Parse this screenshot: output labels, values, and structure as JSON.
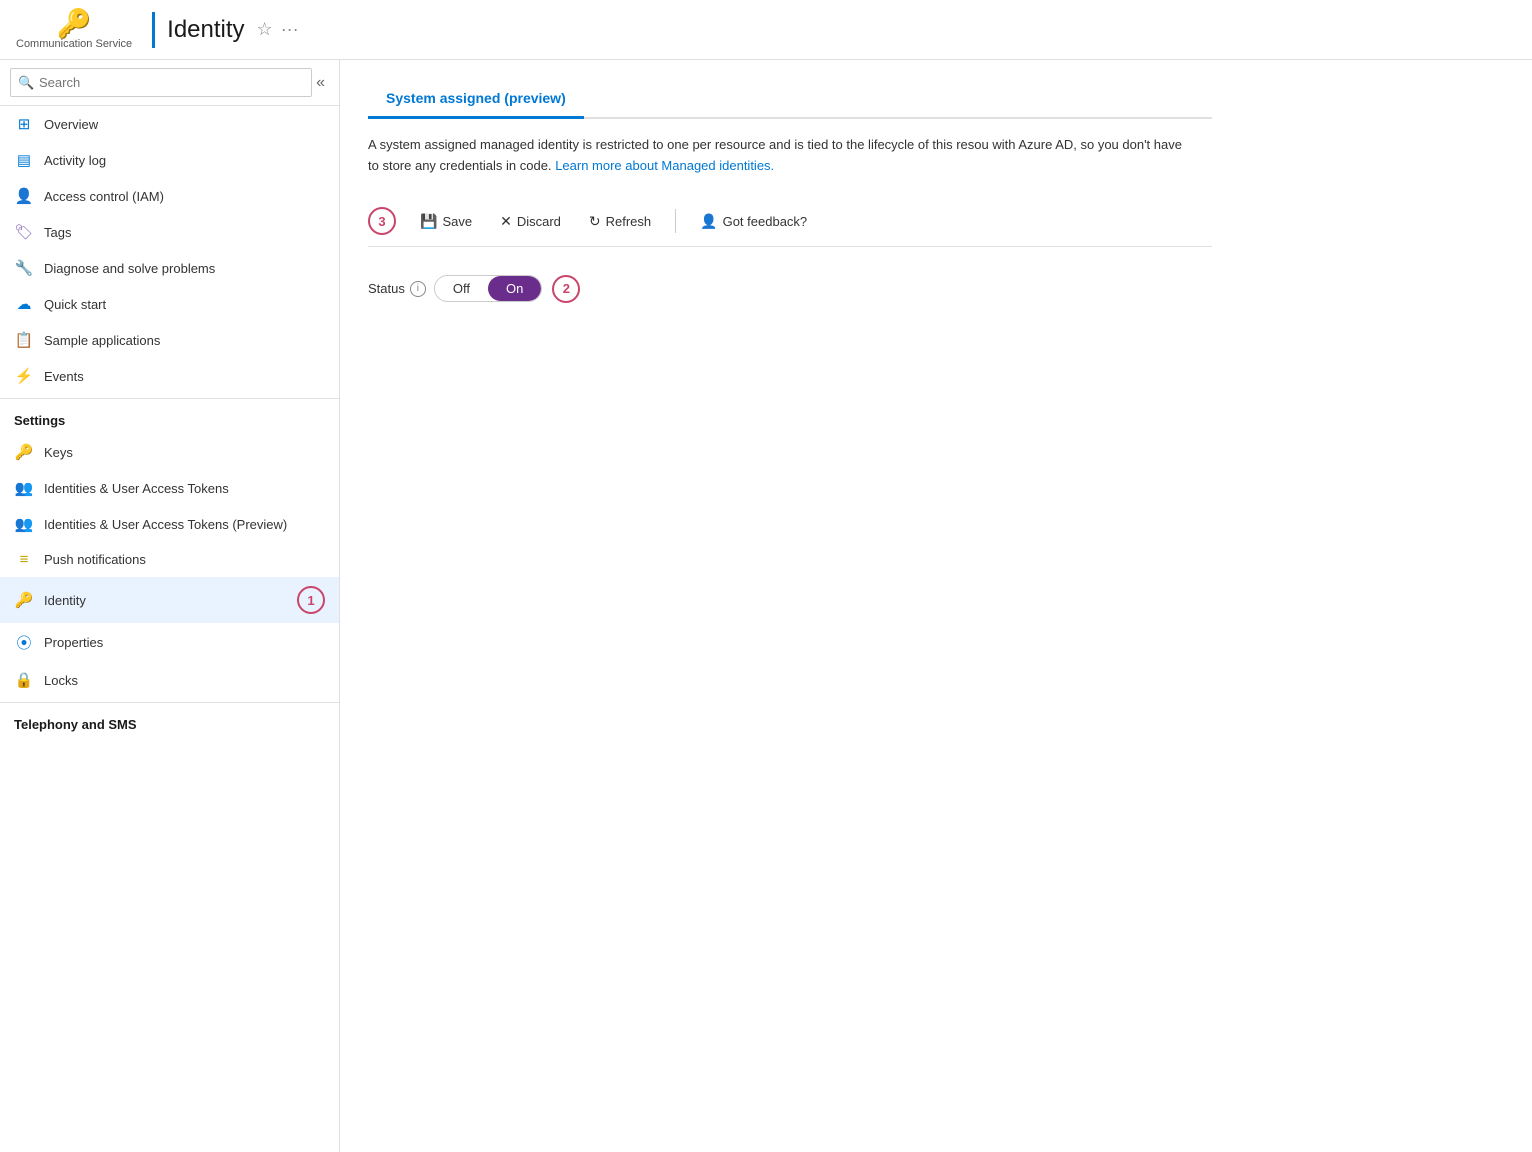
{
  "header": {
    "logo_icon": "🔑",
    "logo_subtitle": "Communication Service",
    "divider_visible": true,
    "title": "Identity",
    "star_icon": "☆",
    "more_icon": "···"
  },
  "sidebar": {
    "search_placeholder": "Search",
    "collapse_icon": "«",
    "items": [
      {
        "id": "overview",
        "label": "Overview",
        "icon": "⊞",
        "icon_color": "icon-blue",
        "active": false
      },
      {
        "id": "activity-log",
        "label": "Activity log",
        "icon": "≡",
        "icon_color": "icon-blue",
        "active": false
      },
      {
        "id": "access-control",
        "label": "Access control (IAM)",
        "icon": "👤",
        "icon_color": "icon-blue",
        "active": false
      },
      {
        "id": "tags",
        "label": "Tags",
        "icon": "🏷",
        "icon_color": "icon-purple",
        "active": false
      },
      {
        "id": "diagnose",
        "label": "Diagnose and solve problems",
        "icon": "🔧",
        "icon_color": "icon-blue",
        "active": false
      },
      {
        "id": "quick-start",
        "label": "Quick start",
        "icon": "☁",
        "icon_color": "icon-blue",
        "active": false
      },
      {
        "id": "sample-applications",
        "label": "Sample applications",
        "icon": "📋",
        "icon_color": "icon-blue",
        "active": false
      },
      {
        "id": "events",
        "label": "Events",
        "icon": "⚡",
        "icon_color": "icon-orange",
        "active": false
      }
    ],
    "settings_section": {
      "label": "Settings",
      "items": [
        {
          "id": "keys",
          "label": "Keys",
          "icon": "🔑",
          "icon_color": "icon-gold",
          "active": false
        },
        {
          "id": "identities-tokens",
          "label": "Identities & User Access Tokens",
          "icon": "👥",
          "icon_color": "icon-teal",
          "active": false
        },
        {
          "id": "identities-tokens-preview",
          "label": "Identities & User Access Tokens (Preview)",
          "icon": "👥",
          "icon_color": "icon-lightblue",
          "active": false
        },
        {
          "id": "push-notifications",
          "label": "Push notifications",
          "icon": "≡",
          "icon_color": "icon-gold",
          "active": false
        },
        {
          "id": "identity",
          "label": "Identity",
          "icon": "🔑",
          "icon_color": "icon-yellow",
          "active": true
        }
      ]
    },
    "bottom_items": [
      {
        "id": "properties",
        "label": "Properties",
        "icon": "⦿",
        "icon_color": "icon-blue",
        "active": false
      },
      {
        "id": "locks",
        "label": "Locks",
        "icon": "🔒",
        "icon_color": "icon-blue",
        "active": false
      }
    ],
    "telephony_section": {
      "label": "Telephony and SMS"
    }
  },
  "content": {
    "tabs": [
      {
        "id": "system-assigned",
        "label": "System assigned (preview)",
        "active": true
      }
    ],
    "description": "A system assigned managed identity is restricted to one per resource and is tied to the lifecycle of this resou with Azure AD, so you don't have to store any credentials in code.",
    "learn_more_text": "Learn more about Managed identities.",
    "learn_more_url": "#",
    "toolbar": {
      "save_label": "Save",
      "discard_label": "Discard",
      "refresh_label": "Refresh",
      "feedback_label": "Got feedback?",
      "save_icon": "💾",
      "discard_icon": "✕",
      "refresh_icon": "↻",
      "feedback_icon": "👤"
    },
    "status": {
      "label": "Status",
      "toggle_off": "Off",
      "toggle_on": "On",
      "current_value": "on"
    },
    "step_badges": {
      "toolbar_badge": "3",
      "toggle_badge": "2"
    }
  }
}
